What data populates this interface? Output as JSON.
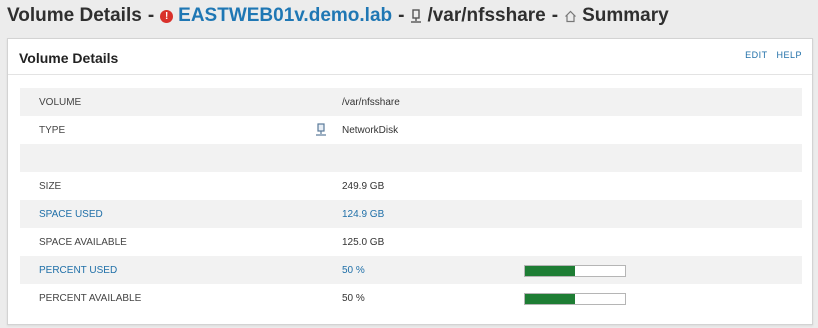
{
  "header": {
    "title": "Volume Details",
    "separator": "-",
    "node_name": "EASTWEB01v.demo.lab",
    "volume_path": "/var/nfsshare",
    "view_name": "Summary",
    "status_icon": "alert-icon",
    "status_color": "#d9312b"
  },
  "panel": {
    "title": "Volume Details",
    "edit_label": "EDIT",
    "help_label": "HELP"
  },
  "rows": {
    "volume": {
      "label": "VOLUME",
      "value": "/var/nfsshare"
    },
    "type": {
      "label": "TYPE",
      "value": "NetworkDisk",
      "icon": "network-disk-icon"
    },
    "size": {
      "label": "SIZE",
      "value": "249.9 GB"
    },
    "space_used": {
      "label": "SPACE USED",
      "value": "124.9 GB"
    },
    "space_available": {
      "label": "SPACE AVAILABLE",
      "value": "125.0 GB"
    },
    "percent_used": {
      "label": "PERCENT USED",
      "value": "50 %",
      "fraction": 0.5
    },
    "percent_available": {
      "label": "PERCENT AVAILABLE",
      "value": "50 %",
      "fraction": 0.5
    }
  },
  "colors": {
    "link": "#1f6fa8",
    "bar_fill": "#1e7d34"
  }
}
